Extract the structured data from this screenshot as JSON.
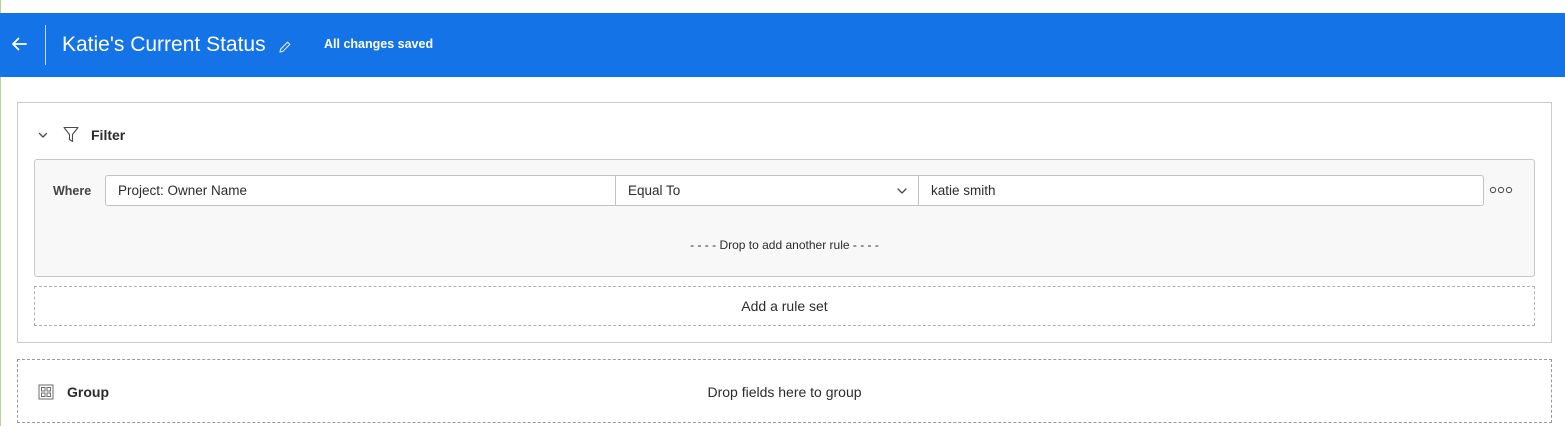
{
  "header": {
    "title": "Katie's Current Status",
    "save_status": "All changes saved",
    "back_icon": "arrow-left-icon",
    "edit_icon": "pencil-icon",
    "background_color": "#1473e6"
  },
  "filter": {
    "title": "Filter",
    "collapse_icon": "chevron-down-icon",
    "filter_icon": "funnel-icon",
    "rule_set": {
      "where_label": "Where",
      "rules": [
        {
          "field": "Project: Owner Name",
          "operator": "Equal To",
          "value": "katie smith"
        }
      ],
      "drop_hint": "- - - - Drop to add another rule - - - -"
    },
    "add_rule_set_label": "Add a rule set"
  },
  "group": {
    "title": "Group",
    "group_icon": "grid-icon",
    "drop_hint": "Drop fields here to group"
  }
}
